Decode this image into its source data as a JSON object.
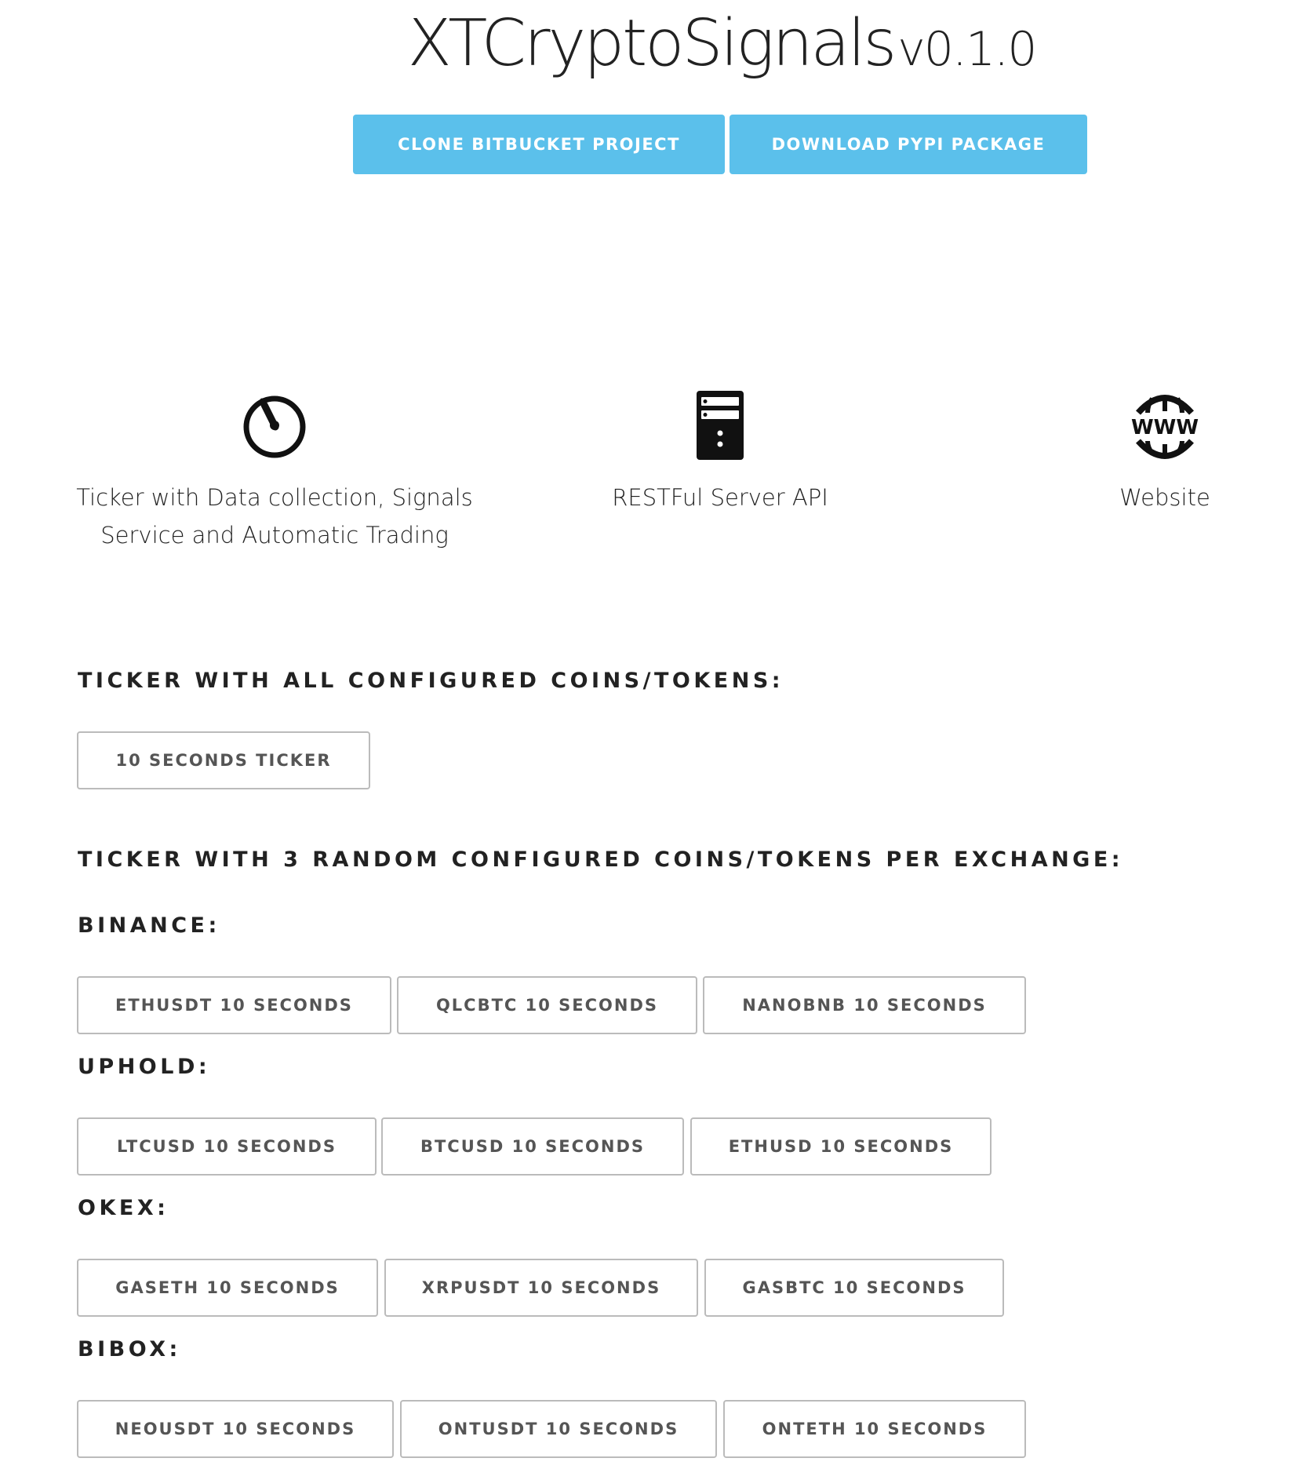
{
  "header": {
    "title": "XTCryptoSignals",
    "version": "v0.1.0"
  },
  "actions": {
    "clone_label": "CLONE BITBUCKET PROJECT",
    "download_label": "DOWNLOAD PYPI PACKAGE"
  },
  "features": [
    {
      "icon": "speedometer-icon",
      "line1": "Ticker with Data collection, Signals",
      "line2": "Service and Automatic Trading"
    },
    {
      "icon": "server-icon",
      "line1": "RESTFul Server API"
    },
    {
      "icon": "www-globe-icon",
      "line1": "Website"
    }
  ],
  "ticker_all": {
    "heading": "TICKER WITH ALL CONFIGURED COINS/TOKENS:",
    "button_label": "10 SECONDS TICKER"
  },
  "ticker_random": {
    "heading": "TICKER WITH 3 RANDOM CONFIGURED COINS/TOKENS PER EXCHANGE:"
  },
  "exchanges": [
    {
      "name": "BINANCE:",
      "buttons": [
        "ETHUSDT 10 SECONDS",
        "QLCBTC 10 SECONDS",
        "NANOBNB 10 SECONDS"
      ]
    },
    {
      "name": "UPHOLD:",
      "buttons": [
        "LTCUSD 10 SECONDS",
        "BTCUSD 10 SECONDS",
        "ETHUSD 10 SECONDS"
      ]
    },
    {
      "name": "OKEX:",
      "buttons": [
        "GASETH 10 SECONDS",
        "XRPUSDT 10 SECONDS",
        "GASBTC 10 SECONDS"
      ]
    },
    {
      "name": "BIBOX:",
      "buttons": [
        "NEOUSDT 10 SECONDS",
        "ONTUSDT 10 SECONDS",
        "ONTETH 10 SECONDS"
      ]
    }
  ],
  "colors": {
    "primary_button": "#5bc0eb",
    "outline_border": "#bbbbbb",
    "text": "#222222"
  }
}
